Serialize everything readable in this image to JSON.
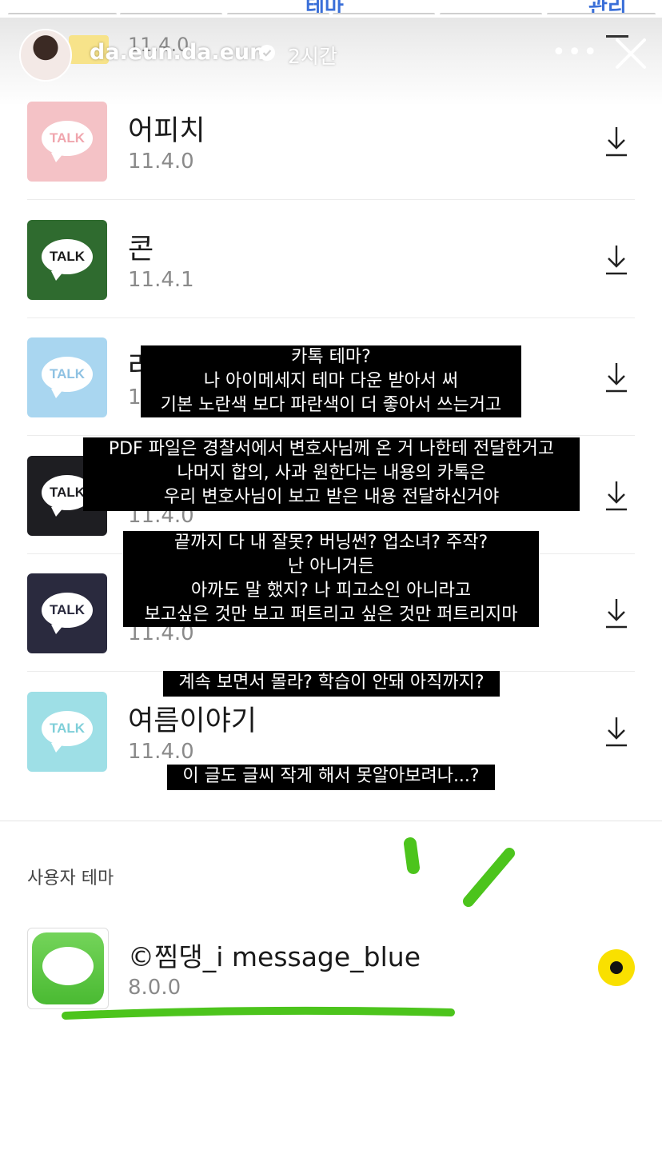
{
  "top_tabs": {
    "center": "테마",
    "right": "관리"
  },
  "story": {
    "username": "da.eun.da.eun",
    "time": "2시간",
    "more_glyph": "•••",
    "peek_version": "11.4.0"
  },
  "themes": [
    {
      "name": "어피치",
      "version": "11.4.0",
      "icon_bg": "#f4c2c6",
      "talk_color": "#f0a6ae"
    },
    {
      "name": "콘",
      "version": "11.4.1",
      "icon_bg": "#2f6b2f",
      "talk_color": "#1a1a1a"
    },
    {
      "name": "라",
      "version": "11",
      "icon_bg": "#a9d6f0",
      "talk_color": "#8fc2e3"
    },
    {
      "name": "",
      "version": "11.4.0",
      "icon_bg": "#1e1e22",
      "talk_color": "#1e1e22"
    },
    {
      "name": "",
      "version": "11.4.0",
      "icon_bg": "#2a2a3e",
      "talk_color": "#2a2a3e"
    },
    {
      "name": "여름이야기",
      "version": "11.4.0",
      "icon_bg": "#9edfe6",
      "talk_color": "#7fcfd9"
    }
  ],
  "talk_label": "TALK",
  "captions": {
    "c1": [
      "카톡 테마?",
      "나 아이메세지 테마 다운 받아서 써",
      "기본 노란색 보다 파란색이 더 좋아서 쓰는거고"
    ],
    "c2": [
      "PDF 파일은 경찰서에서 변호사님께 온 거 나한테 전달한거고",
      "나머지 합의, 사과 원한다는 내용의 카톡은",
      "우리 변호사님이 보고 받은 내용 전달하신거야"
    ],
    "c3": [
      "끝까지 다 내 잘못? 버닝썬? 업소녀? 주작?",
      "난 아니거든",
      "아까도 말 했지? 나 피고소인 아니라고",
      "보고싶은 것만 보고 퍼트리고 싶은 것만 퍼트리지마"
    ],
    "c4": [
      "계속 보면서 몰라? 학습이 안돼 아직까지?"
    ],
    "c5": [
      "이 글도 글씨 작게 해서 못알아보려나...?"
    ]
  },
  "user_theme": {
    "section_label": "사용자 테마",
    "name": "©찜댕_i message_blue",
    "version": "8.0.0"
  },
  "colors": {
    "highlight_green": "#4cc41c",
    "selected_yellow": "#f9e000"
  }
}
